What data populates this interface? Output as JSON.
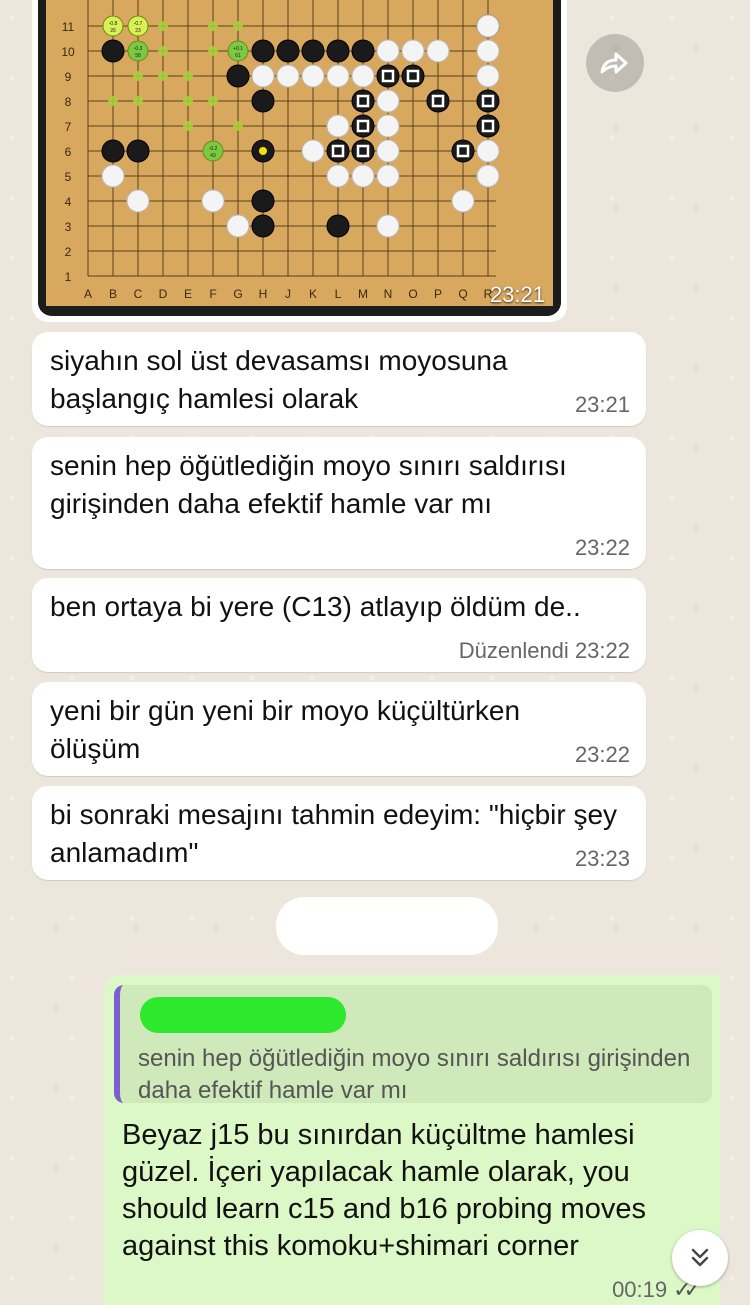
{
  "image_message": {
    "time": "23:21",
    "board": {
      "columns": [
        "A",
        "B",
        "C",
        "D",
        "E",
        "F",
        "G",
        "H",
        "J",
        "K",
        "L",
        "M",
        "N",
        "O",
        "P",
        "Q",
        "R"
      ],
      "rows": [
        "11",
        "10",
        "9",
        "8",
        "7",
        "6",
        "5",
        "4",
        "3",
        "2",
        "1"
      ],
      "stone_labels": [
        "-0.8 26",
        "-0.7 23",
        "-0.3 58",
        "+0.1 61",
        "-0.2 43"
      ]
    }
  },
  "messages": [
    {
      "text": "siyahın sol üst devasamsı moyosuna başlangıç hamlesi olarak",
      "time": "23:21",
      "edited": ""
    },
    {
      "text": "senin hep öğütlediğin moyo sınırı saldırısı girişinden daha efektif hamle var mı",
      "time": "23:22",
      "edited": ""
    },
    {
      "text": "ben ortaya bi yere (C13) atlayıp öldüm de..",
      "time": "23:22",
      "edited": "Düzenlendi"
    },
    {
      "text": "yeni bir gün yeni bir moyo küçültürken ölüşüm",
      "time": "23:22",
      "edited": ""
    },
    {
      "text": "bi sonraki mesajını tahmin edeyim: \"hiçbir şey anlamadım\"",
      "time": "23:23",
      "edited": ""
    }
  ],
  "reply": {
    "quoted_text": "senin hep öğütlediğin moyo sınırı saldırısı girişinden daha efektif hamle var mı",
    "text": "Beyaz j15 bu sınırdan küçültme hamlesi güzel. İçeri yapılacak hamle olarak, you should learn c15 and b16 probing moves against this komoku+shimari corner",
    "time": "00:19",
    "status_icon": "double-check-icon"
  },
  "colors": {
    "outgoing": "#dcf8c6",
    "incoming": "#ffffff",
    "quote_bar": "#7b5fd0"
  }
}
